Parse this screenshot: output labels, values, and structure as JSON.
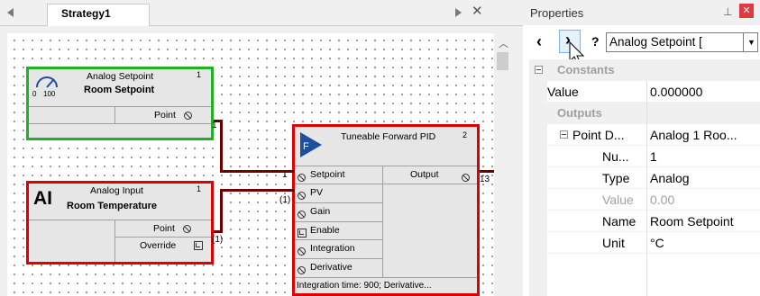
{
  "document_tab": {
    "title": "Strategy1"
  },
  "blocks": {
    "analog_setpoint": {
      "type_label": "Analog Setpoint",
      "index": "1",
      "name": "Room Setpoint",
      "icon_min": "0",
      "icon_max": "100",
      "output_label": "Point",
      "output_connection": "1"
    },
    "analog_input": {
      "icon_text": "AI",
      "type_label": "Analog Input",
      "index": "1",
      "name": "Room Temperature",
      "output_label": "Point",
      "override_label": "Override",
      "output_connection": "(1)"
    },
    "pid": {
      "icon_text": "F",
      "type_label": "Tuneable Forward PID",
      "index": "2",
      "inputs": [
        "Setpoint",
        "PV",
        "Gain",
        "Enable",
        "Integration",
        "Derivative"
      ],
      "output_label": "Output",
      "output_connection": "13",
      "setpoint_connection": "1",
      "pv_connection": "(1)",
      "footer": "Integration time: 900; Derivative..."
    }
  },
  "properties": {
    "title": "Properties",
    "selected_object": "Analog Setpoint [",
    "categories": [
      {
        "name": "Constants",
        "rows": [
          {
            "name": "Value",
            "value": "0.000000",
            "muted": false
          }
        ]
      },
      {
        "name": "Outputs",
        "rows": [
          {
            "name": "Point D...",
            "value": "Analog 1 Roo...",
            "muted": false
          },
          {
            "name": "Nu...",
            "value": "1",
            "muted": false
          },
          {
            "name": "Type",
            "value": "Analog",
            "muted": false
          },
          {
            "name": "Value",
            "value": "0.00",
            "muted": true
          },
          {
            "name": "Name",
            "value": "Room Setpoint",
            "muted": false
          },
          {
            "name": "Unit",
            "value": "°C",
            "muted": false
          }
        ]
      }
    ]
  },
  "colors": {
    "setpoint_border": "#23b023",
    "error_border": "#dd0000",
    "wire": "#6a0000",
    "pid_icon": "#1f4e9c",
    "close_accent": "#e0393e"
  }
}
